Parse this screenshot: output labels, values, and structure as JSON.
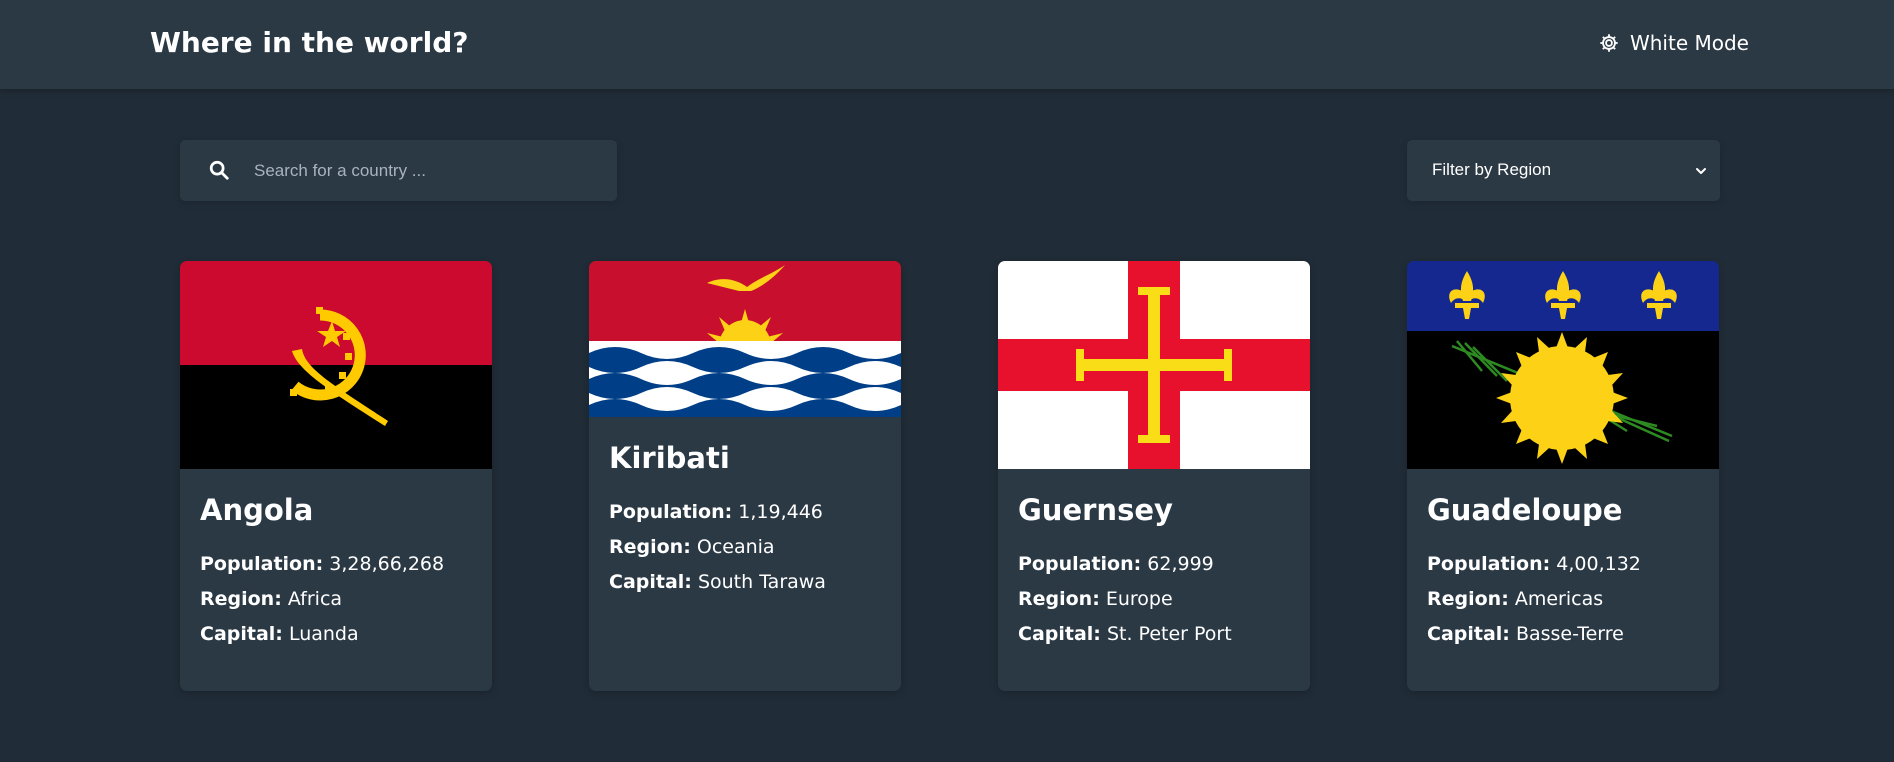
{
  "header": {
    "title": "Where in the world?",
    "mode_label": "White Mode"
  },
  "search": {
    "placeholder": "Search for a country ..."
  },
  "filter": {
    "label": "Filter by Region"
  },
  "labels": {
    "population": "Population:",
    "region": "Region:",
    "capital": "Capital:"
  },
  "countries": [
    {
      "name": "Angola",
      "population": "3,28,66,268",
      "region": "Africa",
      "capital": "Luanda"
    },
    {
      "name": "Kiribati",
      "population": "1,19,446",
      "region": "Oceania",
      "capital": "South Tarawa"
    },
    {
      "name": "Guernsey",
      "population": "62,999",
      "region": "Europe",
      "capital": "St. Peter Port"
    },
    {
      "name": "Guadeloupe",
      "population": "4,00,132",
      "region": "Americas",
      "capital": "Basse-Terre"
    }
  ],
  "colors": {
    "background": "#202c37",
    "surface": "#2b3945",
    "text": "#ffffff"
  },
  "icons": [
    "gear-icon",
    "search-icon",
    "chevron-down-icon"
  ]
}
